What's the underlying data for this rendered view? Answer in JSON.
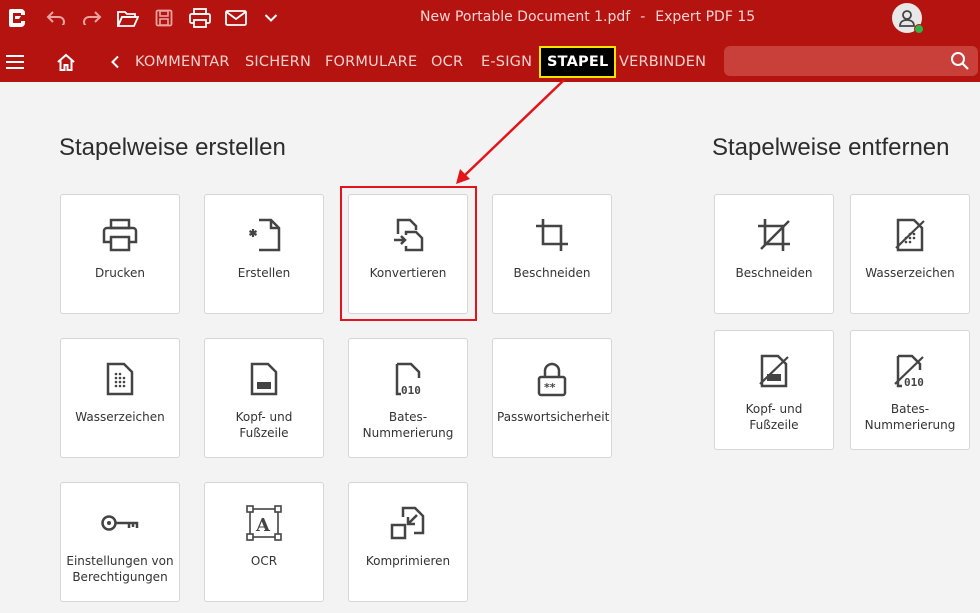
{
  "window": {
    "file_name": "New Portable Document 1.pdf",
    "separator": "-",
    "app_name": "Expert PDF 15"
  },
  "ribbon": {
    "tabs": [
      {
        "label": "KOMMENTAR"
      },
      {
        "label": "SICHERN"
      },
      {
        "label": "FORMULARE"
      },
      {
        "label": "OCR"
      },
      {
        "label": "E-SIGN"
      },
      {
        "label": "STAPEL",
        "active": true
      },
      {
        "label": "VERBINDEN"
      }
    ],
    "search_placeholder": ""
  },
  "create": {
    "title": "Stapelweise erstellen",
    "items": [
      {
        "label": "Drucken",
        "icon": "printer-icon"
      },
      {
        "label": "Erstellen",
        "icon": "new-document-icon"
      },
      {
        "label": "Konvertieren",
        "icon": "convert-icon"
      },
      {
        "label": "Beschneiden",
        "icon": "crop-icon"
      },
      {
        "label": "Wasserzeichen",
        "icon": "watermark-icon"
      },
      {
        "label": "Kopf- und\nFußzeile",
        "icon": "header-footer-icon"
      },
      {
        "label": "Bates-\nNummerierung",
        "icon": "bates-icon"
      },
      {
        "label": "Passwortsicherheit",
        "icon": "lock-icon"
      },
      {
        "label": "Einstellungen von\nBerechtigungen",
        "icon": "key-icon"
      },
      {
        "label": "OCR",
        "icon": "ocr-icon"
      },
      {
        "label": "Komprimieren",
        "icon": "compress-icon"
      }
    ]
  },
  "remove": {
    "title": "Stapelweise entfernen",
    "items": [
      {
        "label": "Beschneiden",
        "icon": "crop-remove-icon"
      },
      {
        "label": "Wasserzeichen",
        "icon": "watermark-remove-icon"
      },
      {
        "label": "Kopf- und\nFußzeile",
        "icon": "header-footer-remove-icon"
      },
      {
        "label": "Bates-\nNummerierung",
        "icon": "bates-remove-icon"
      }
    ]
  },
  "colors": {
    "brand_red": "#b5130f",
    "highlight_red": "#e3141a",
    "active_tab_border": "#f5e400"
  }
}
